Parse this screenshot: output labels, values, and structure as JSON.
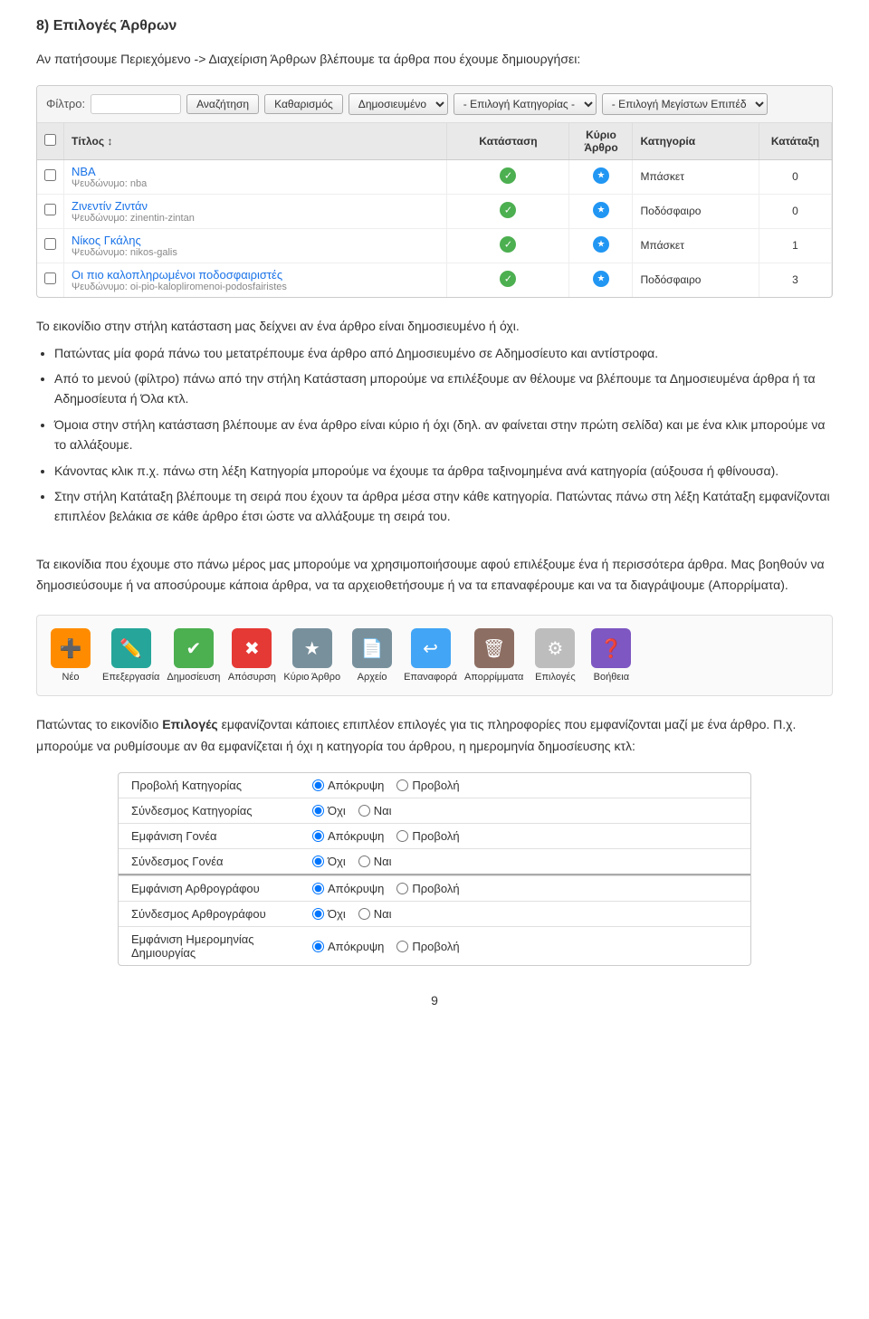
{
  "heading": {
    "number": "8)",
    "title": "Επιλογές Άρθρων",
    "intro": "Αν πατήσουμε Περιεχόμενο -> Διαχείριση Άρθρων βλέπουμε τα άρθρα που έχουμε δημιουργήσει:"
  },
  "cms": {
    "filter_label": "Φίλτρο:",
    "filter_value": "",
    "search_btn": "Αναζήτηση",
    "clear_btn": "Καθαρισμός",
    "status_select": "Δημοσιευμένο",
    "category_select": "- Επιλογή Κατηγορίας -",
    "maxitems_select": "- Επιλογή Μεγίστων Επιπέδ",
    "columns": {
      "title": "Τίτλος",
      "status": "Κατάσταση",
      "main_article": "Κύριο Άρθρο",
      "category": "Κατηγορία",
      "rank": "Κατάταξη"
    },
    "rows": [
      {
        "title": "NBA",
        "pseudo": "Ψευδώνυμο: nba",
        "status": "check",
        "main": "star",
        "category": "Μπάσκετ",
        "rank": "0"
      },
      {
        "title": "Ζινεντίν Ζιντάν",
        "pseudo": "Ψευδώνυμο: zinentin-zintan",
        "status": "check",
        "main": "star",
        "category": "Ποδόσφαιρο",
        "rank": "0"
      },
      {
        "title": "Νίκος Γκάλης",
        "pseudo": "Ψευδώνυμο: nikos-galis",
        "status": "check",
        "main": "star",
        "category": "Μπάσκετ",
        "rank": "1"
      },
      {
        "title": "Οι πιο καλοπληρωμένοι ποδοσφαιριστές",
        "pseudo": "Ψευδώνυμο: oi-pio-kalopliromenoi-podosfairistes",
        "status": "check",
        "main": "star",
        "category": "Ποδόσφαιρο",
        "rank": "3"
      }
    ]
  },
  "body_paragraphs": {
    "p1": "Το εικονίδιο στην στήλη κατάσταση μας δείχνει αν ένα άρθρο είναι δημοσιευμένο ή όχι.",
    "p2": "Πατώντας μία φορά πάνω του μετατρέπουμε ένα άρθρο από Δημοσιευμένο σε Αδημοσίευτο και αντίστροφα.",
    "p3": "Από το μενού (φίλτρο) πάνω από την στήλη Κατάσταση μπορούμε να επιλέξουμε αν θέλουμε να βλέπουμε τα Δημοσιευμένα άρθρα ή τα Αδημοσίευτα ή Όλα κτλ.",
    "p4_prefix": "Όμοια στην στήλη κατάσταση βλέπουμε αν ένα άρθρο είναι κύριο ή όχι (δηλ. αν φαίνεται στην πρώτη σελίδα) και με ένα κλικ μπορούμε να το αλλάξουμε.",
    "p5": "Κάνοντας κλικ π.χ. πάνω στη λέξη Κατηγορία μπορούμε να έχουμε τα άρθρα ταξινομημένα ανά κατηγορία (αύξουσα ή φθίνουσα).",
    "p6": "Στην στήλη Κατάταξη βλέπουμε τη σειρά που έχουν τα άρθρα μέσα στην κάθε κατηγορία. Πατώντας πάνω στη λέξη Κατάταξη εμφανίζονται επιπλέον βελάκια σε κάθε άρθρο έτσι ώστε να αλλάξουμε τη σειρά του.",
    "p7": "Τα εικονίδια που έχουμε στο πάνω μέρος μας μπορούμε να χρησιμοποιήσουμε αφού επιλέξουμε ένα ή περισσότερα άρθρα. Μας βοηθούν να δημοσιεύσουμε ή να αποσύρουμε κάποια άρθρα, να τα αρχειοθετήσουμε ή να τα επαναφέρουμε και να τα διαγράψουμε (Απορρίματα).",
    "p8_prefix": "Πατώντας το εικονίδιο ",
    "p8_bold": "Επιλογές",
    "p8_suffix": " εμφανίζονται κάποιες επιπλέον επιλογές για τις πληροφορίες που εμφανίζονται μαζί με ένα άρθρο. Π.χ. μπορούμε να ρυθμίσουμε αν θα εμφανίζεται ή όχι η κατηγορία του άρθρου, η ημερομηνία δημοσίευσης κτλ:"
  },
  "action_buttons": [
    {
      "icon": "➕",
      "label": "Νέο",
      "color": "btn-orange"
    },
    {
      "icon": "✏️",
      "label": "Επεξεργασία",
      "color": "btn-teal"
    },
    {
      "icon": "✔",
      "label": "Δημοσίευση",
      "color": "btn-green"
    },
    {
      "icon": "✖",
      "label": "Απόσυρση",
      "color": "btn-red"
    },
    {
      "icon": "★",
      "label": "Κύριο Άρθρο",
      "color": "btn-gray"
    },
    {
      "icon": "📄",
      "label": "Αρχείο",
      "color": "btn-gray"
    },
    {
      "icon": "↩",
      "label": "Επαναφορά",
      "color": "btn-blue"
    },
    {
      "icon": "🗑",
      "label": "Απορρίμματα",
      "color": "btn-brown"
    },
    {
      "icon": "⚙",
      "label": "Επιλογές",
      "color": "btn-lgray"
    },
    {
      "icon": "❓",
      "label": "Βοήθεια",
      "color": "btn-purple"
    }
  ],
  "options_table": {
    "groups": [
      {
        "rows": [
          {
            "label": "Προβολή Κατηγορίας",
            "options": [
              {
                "value": "apokrypsi",
                "text": "Απόκρυψη",
                "checked": true
              },
              {
                "value": "provoli",
                "text": "Προβολή",
                "checked": false
              }
            ]
          },
          {
            "label": "Σύνδεσμος Κατηγορίας",
            "options": [
              {
                "value": "ochi",
                "text": "Όχι",
                "checked": true
              },
              {
                "value": "nai",
                "text": "Ναι",
                "checked": false
              }
            ]
          },
          {
            "label": "Εμφάνιση Γονέα",
            "options": [
              {
                "value": "apokrypsi",
                "text": "Απόκρυψη",
                "checked": true
              },
              {
                "value": "provoli",
                "text": "Προβολή",
                "checked": false
              }
            ]
          },
          {
            "label": "Σύνδεσμος Γονέα",
            "options": [
              {
                "value": "ochi",
                "text": "Όχι",
                "checked": true
              },
              {
                "value": "nai",
                "text": "Ναι",
                "checked": false
              }
            ]
          }
        ]
      },
      {
        "rows": [
          {
            "label": "Εμφάνιση Αρθρογράφου",
            "options": [
              {
                "value": "apokrypsi",
                "text": "Απόκρυψη",
                "checked": true
              },
              {
                "value": "provoli",
                "text": "Προβολή",
                "checked": false
              }
            ]
          },
          {
            "label": "Σύνδεσμος Αρθρογράφου",
            "options": [
              {
                "value": "ochi",
                "text": "Όχι",
                "checked": true
              },
              {
                "value": "nai",
                "text": "Ναι",
                "checked": false
              }
            ]
          },
          {
            "label": "Εμφάνιση Ημερομηνίας Δημιουργίας",
            "options": [
              {
                "value": "apokrypsi",
                "text": "Απόκρυψη",
                "checked": true
              },
              {
                "value": "provoli",
                "text": "Προβολή",
                "checked": false
              }
            ]
          }
        ]
      }
    ]
  },
  "page_number": "9"
}
